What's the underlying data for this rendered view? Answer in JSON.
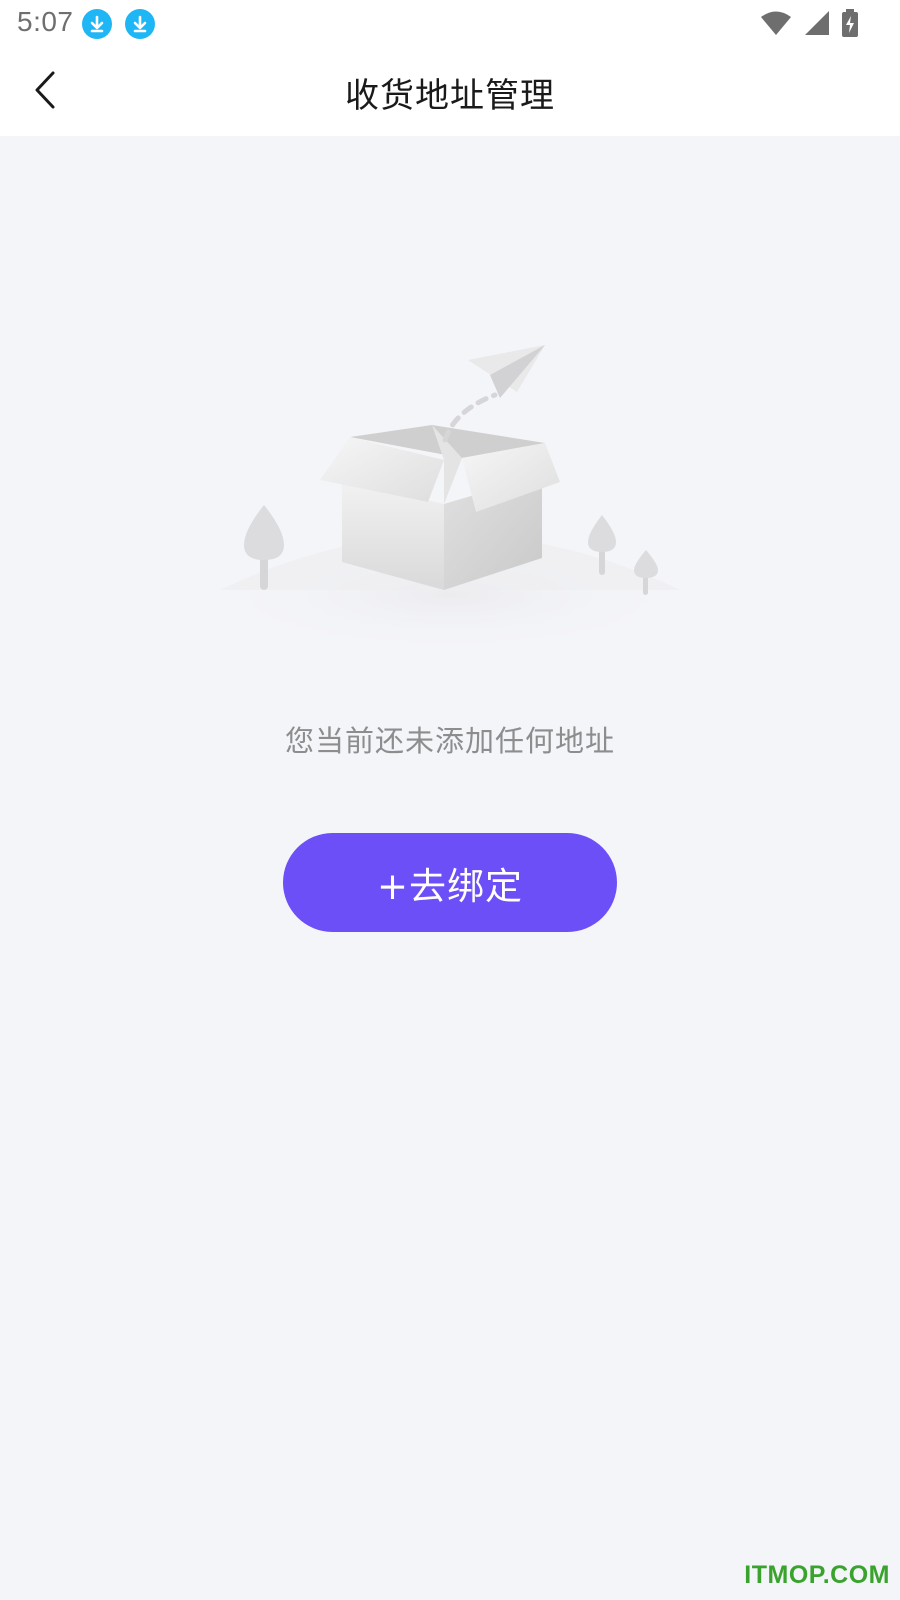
{
  "status_bar": {
    "time": "5:07",
    "icons": [
      "download-icon",
      "download-icon",
      "wifi-icon",
      "cell-signal-icon",
      "battery-charging-icon"
    ],
    "accent_color": "#1fb6f5"
  },
  "header": {
    "back_icon": "chevron-left-icon",
    "title": "收货地址管理"
  },
  "empty_state": {
    "illustration": "empty-box-paper-plane-illustration",
    "message": "您当前还未添加任何地址"
  },
  "actions": {
    "bind_label": "+去绑定",
    "button_color": "#6c4ff7"
  },
  "watermark": "ITMOP.COM"
}
